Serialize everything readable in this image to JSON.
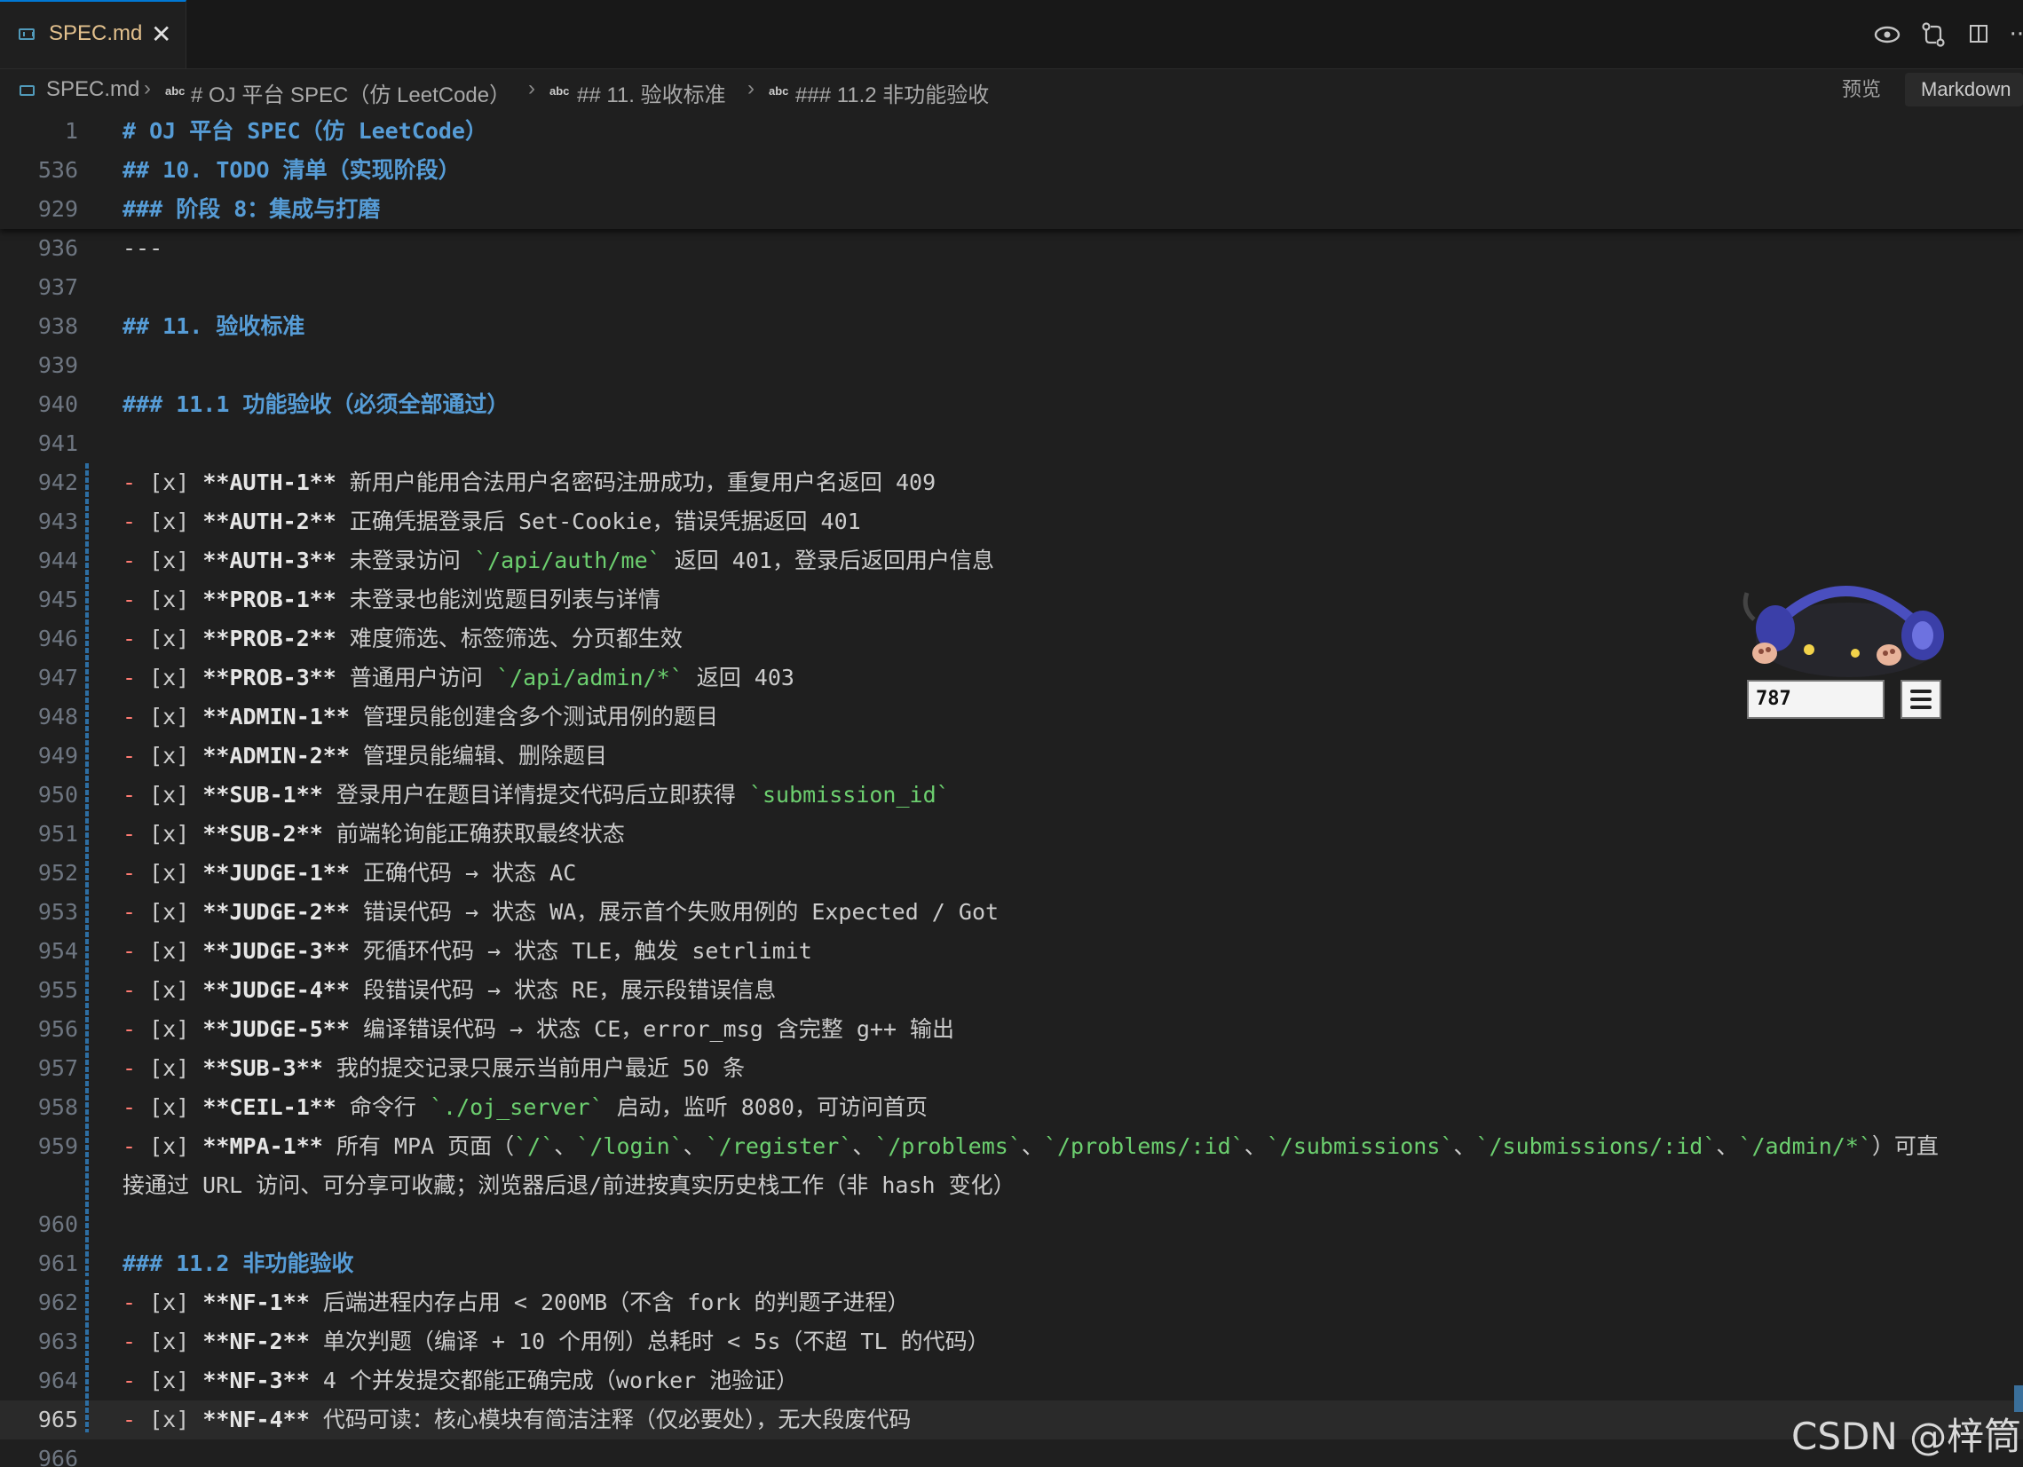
{
  "tab": {
    "label": "SPEC.md",
    "close": "✕"
  },
  "actions": {
    "preview_icon": "eye-icon",
    "diff_icon": "compare-changes-icon",
    "split_icon": "split-editor-icon",
    "more_icon": "more-icon",
    "more_glyph": "···"
  },
  "breadcrumb": {
    "file": "SPEC.md",
    "items": [
      "# OJ 平台 SPEC（仿 LeetCode）",
      "## 11. 验收标准",
      "### 11.2 非功能验收"
    ],
    "abc": "abc",
    "preview": "预览",
    "mode": "Markdown"
  },
  "sticky": [
    {
      "n": "1",
      "text": "# OJ 平台 SPEC（仿 LeetCode）"
    },
    {
      "n": "536",
      "text": "## 10. TODO 清单（实现阶段）"
    },
    {
      "n": "929",
      "text": "### 阶段 8：集成与打磨"
    }
  ],
  "lines": [
    {
      "n": "936",
      "text": "---"
    },
    {
      "n": "937",
      "text": ""
    },
    {
      "n": "938",
      "heading": "## 11. 验收标准"
    },
    {
      "n": "939",
      "text": ""
    },
    {
      "n": "940",
      "heading": "### 11.1 功能验收（必须全部通过）"
    },
    {
      "n": "941",
      "text": ""
    },
    {
      "n": "942",
      "id": "**AUTH-1**",
      "parts": [
        [
          "t",
          " 新用户能用合法用户名密码注册成功，重复用户名返回 409"
        ]
      ]
    },
    {
      "n": "943",
      "id": "**AUTH-2**",
      "parts": [
        [
          "t",
          " 正确凭据登录后 Set-Cookie，错误凭据返回 401"
        ]
      ]
    },
    {
      "n": "944",
      "id": "**AUTH-3**",
      "parts": [
        [
          "t",
          " 未登录访问 "
        ],
        [
          "c",
          "`/api/auth/me`"
        ],
        [
          "t",
          " 返回 401，登录后返回用户信息"
        ]
      ]
    },
    {
      "n": "945",
      "id": "**PROB-1**",
      "parts": [
        [
          "t",
          " 未登录也能浏览题目列表与详情"
        ]
      ]
    },
    {
      "n": "946",
      "id": "**PROB-2**",
      "parts": [
        [
          "t",
          " 难度筛选、标签筛选、分页都生效"
        ]
      ]
    },
    {
      "n": "947",
      "id": "**PROB-3**",
      "parts": [
        [
          "t",
          " 普通用户访问 "
        ],
        [
          "c",
          "`/api/admin/*`"
        ],
        [
          "t",
          " 返回 403"
        ]
      ]
    },
    {
      "n": "948",
      "id": "**ADMIN-1**",
      "parts": [
        [
          "t",
          " 管理员能创建含多个测试用例的题目"
        ]
      ]
    },
    {
      "n": "949",
      "id": "**ADMIN-2**",
      "parts": [
        [
          "t",
          " 管理员能编辑、删除题目"
        ]
      ]
    },
    {
      "n": "950",
      "id": "**SUB-1**",
      "parts": [
        [
          "t",
          " 登录用户在题目详情提交代码后立即获得 "
        ],
        [
          "c",
          "`submission_id`"
        ]
      ]
    },
    {
      "n": "951",
      "id": "**SUB-2**",
      "parts": [
        [
          "t",
          " 前端轮询能正确获取最终状态"
        ]
      ]
    },
    {
      "n": "952",
      "id": "**JUDGE-1**",
      "parts": [
        [
          "t",
          " 正确代码 → 状态 AC"
        ]
      ]
    },
    {
      "n": "953",
      "id": "**JUDGE-2**",
      "parts": [
        [
          "t",
          " 错误代码 → 状态 WA，展示首个失败用例的 Expected / Got"
        ]
      ]
    },
    {
      "n": "954",
      "id": "**JUDGE-3**",
      "parts": [
        [
          "t",
          " 死循环代码 → 状态 TLE，触发 setrlimit"
        ]
      ]
    },
    {
      "n": "955",
      "id": "**JUDGE-4**",
      "parts": [
        [
          "t",
          " 段错误代码 → 状态 RE，展示段错误信息"
        ]
      ]
    },
    {
      "n": "956",
      "id": "**JUDGE-5**",
      "parts": [
        [
          "t",
          " 编译错误代码 → 状态 CE，error_msg 含完整 g++ 输出"
        ]
      ]
    },
    {
      "n": "957",
      "id": "**SUB-3**",
      "parts": [
        [
          "t",
          " 我的提交记录只展示当前用户最近 50 条"
        ]
      ]
    },
    {
      "n": "958",
      "id": "**CEIL-1**",
      "parts": [
        [
          "t",
          " 命令行 "
        ],
        [
          "c",
          "`./oj_server`"
        ],
        [
          "t",
          " 启动，监听 8080，可访问首页"
        ]
      ]
    },
    {
      "n": "959",
      "id": "**MPA-1**",
      "parts": [
        [
          "t",
          " 所有 MPA 页面（"
        ],
        [
          "c",
          "`/`"
        ],
        [
          "t",
          "、"
        ],
        [
          "c",
          "`/login`"
        ],
        [
          "t",
          "、"
        ],
        [
          "c",
          "`/register`"
        ],
        [
          "t",
          "、"
        ],
        [
          "c",
          "`/problems`"
        ],
        [
          "t",
          "、"
        ],
        [
          "c",
          "`/problems/:id`"
        ],
        [
          "t",
          "、"
        ],
        [
          "c",
          "`/submissions`"
        ],
        [
          "t",
          "、"
        ],
        [
          "c",
          "`/submissions/:id`"
        ],
        [
          "t",
          "、"
        ],
        [
          "c",
          "`/admin/*`"
        ],
        [
          "t",
          "）可直"
        ]
      ]
    },
    {
      "n": "",
      "wrap": "接通过 URL 访问、可分享可收藏；浏览器后退/前进按真实历史栈工作（非 hash 变化）"
    },
    {
      "n": "960",
      "text": ""
    },
    {
      "n": "961",
      "heading": "### 11.2 非功能验收"
    },
    {
      "n": "962",
      "id": "**NF-1**",
      "parts": [
        [
          "t",
          " 后端进程内存占用 < 200MB（不含 fork 的判题子进程）"
        ]
      ]
    },
    {
      "n": "963",
      "id": "**NF-2**",
      "parts": [
        [
          "t",
          " 单次判题（编译 + 10 个用例）总耗时 < 5s（不超 TL 的代码）"
        ]
      ]
    },
    {
      "n": "964",
      "id": "**NF-3**",
      "parts": [
        [
          "t",
          " 4 个并发提交都能正确完成（worker 池验证）"
        ]
      ]
    },
    {
      "n": "965",
      "id": "**NF-4**",
      "parts": [
        [
          "t",
          " 代码可读：核心模块有简洁注释（仅必要处），无大段废代码"
        ]
      ],
      "active": true
    },
    {
      "n": "966",
      "text": ""
    }
  ],
  "task_prefix": {
    "dash": "-",
    "box": "[x]"
  },
  "widget": {
    "counter": "787",
    "mascot_icon": "cat-with-headphones-icon",
    "menu_icon": "menu-icon"
  },
  "watermark": "CSDN @梓筒"
}
